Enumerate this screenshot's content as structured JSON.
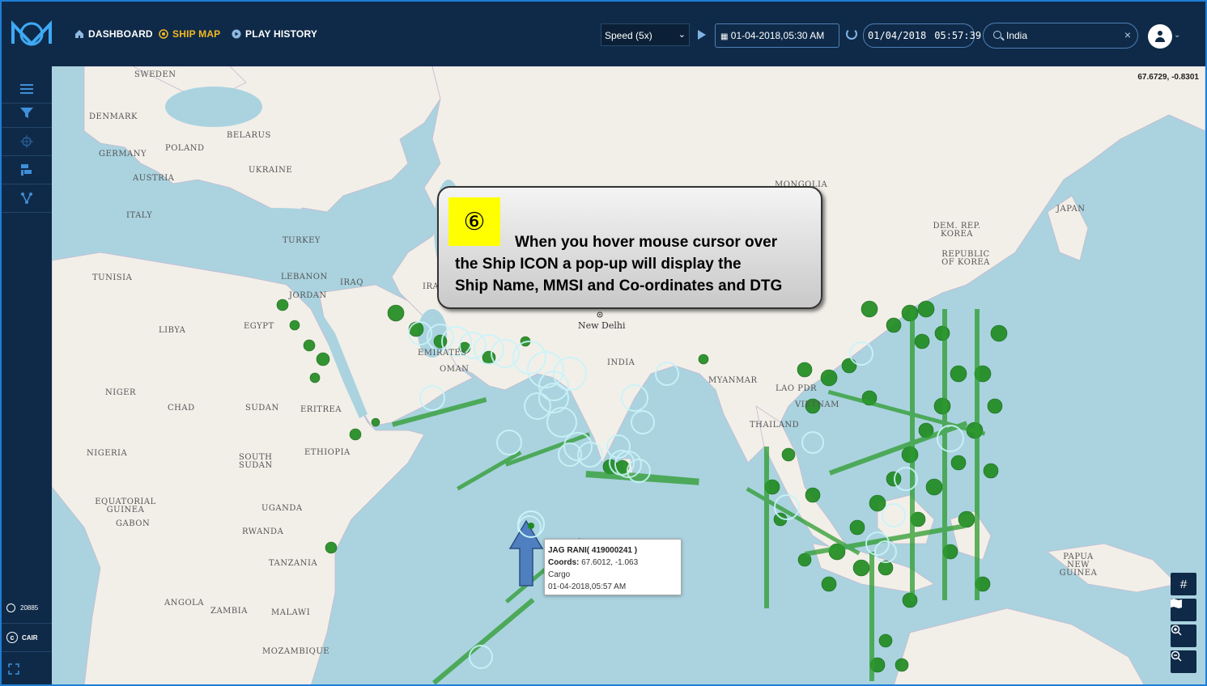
{
  "nav": {
    "dashboard": "DASHBOARD",
    "ship_map": "SHIP MAP",
    "play_history": "PLAY HISTORY"
  },
  "controls": {
    "speed": "Speed (5x)",
    "start_datetime": "01-04-2018,05:30 AM",
    "clock_date": "01/04/2018",
    "clock_time": "05:57:39",
    "search_value": "India"
  },
  "sidebar": {
    "ship_count": "20885",
    "copyright": "CAIR"
  },
  "map": {
    "cursor_coords": "67.6729, -0.8301",
    "countries": [
      "SWEDEN",
      "DENMARK",
      "BELARUS",
      "POLAND",
      "GERMANY",
      "UKRAINE",
      "AUSTRIA",
      "ITALY",
      "TURKEY",
      "TUNISIA",
      "LEBANON",
      "IRAQ",
      "JORDAN",
      "LIBYA",
      "EGYPT",
      "EMIRATES",
      "OMAN",
      "INDIA",
      "MYANMAR",
      "LAO PDR",
      "VIETNAM",
      "THAILAND",
      "MONGOLIA",
      "JAPAN",
      "DEM. REP. KOREA",
      "REPUBLIC OF KOREA",
      "NIGER",
      "CHAD",
      "SUDAN",
      "ERITREA",
      "NIGERIA",
      "ETHIOPIA",
      "SOUTH SUDAN",
      "EQUATORIAL GUINEA",
      "GABON",
      "UGANDA",
      "RWANDA",
      "TANZANIA",
      "ANGOLA",
      "ZAMBIA",
      "MALAWI",
      "MOZAMBIQUE",
      "PAPUA NEW GUINEA",
      "IRAN"
    ],
    "city": "New Delhi"
  },
  "callout": {
    "number": "⑥",
    "line1": "When you hover mouse cursor over",
    "line2": "the  Ship ICON a pop-up will display the",
    "line3": "Ship Name, MMSI and Co-ordinates and DTG"
  },
  "popup": {
    "name": "JAG RANI( 419000241 )",
    "coords_label": "Coords:",
    "coords_value": "67.6012, -1.063",
    "type": "Cargo",
    "dtg": "01-04-2018,05:57 AM"
  },
  "colors": {
    "topbar": "#0f2a48",
    "accent": "#f5b921",
    "ship": "#2e8b2e",
    "sea": "#aad3df",
    "land": "#f2efe9"
  },
  "icons": [
    "logo-icon",
    "home-icon",
    "target-icon",
    "play-circle-icon",
    "play-icon",
    "calendar-icon",
    "reset-icon",
    "search-icon",
    "clear-icon",
    "user-icon",
    "menu-icon",
    "filter-icon",
    "crosshair-icon",
    "layers-icon",
    "network-icon",
    "expand-icon",
    "grid-icon",
    "map-icon",
    "zoom-in-icon",
    "zoom-out-icon"
  ]
}
